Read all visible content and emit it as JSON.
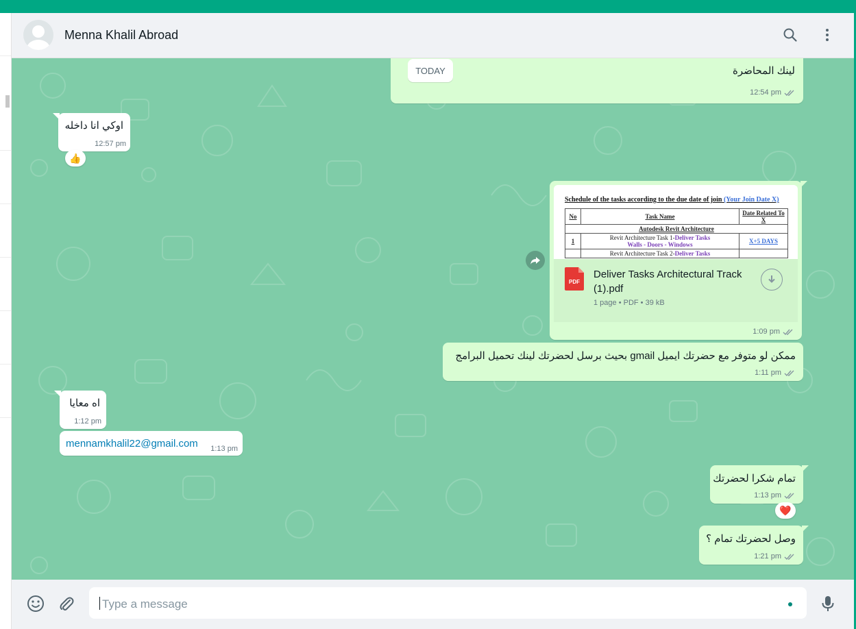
{
  "colors": {
    "accent": "#00a884",
    "chat_bg": "#7fcca8",
    "outgoing": "#d9fdd3",
    "incoming": "#ffffff"
  },
  "header": {
    "contact_name": "Menna Khalil Abroad",
    "icons": [
      "search-icon",
      "menu-dots-icon"
    ]
  },
  "chat": {
    "messages": [
      {
        "dir": "out",
        "text": "لينك المحاضرة",
        "chip": "TODAY",
        "time": "12:54 pm",
        "status": "read"
      },
      {
        "dir": "in",
        "text": "اوكي انا داخله",
        "time": "12:57 pm",
        "reaction": "👍"
      },
      {
        "dir": "out",
        "type": "document",
        "time": "1:09 pm",
        "status": "read",
        "file_name": "Deliver Tasks Architectural Track (1).pdf",
        "file_icon_label": "PDF",
        "file_info": "1 page • PDF • 39 kB",
        "preview": {
          "title": "Schedule of the tasks according to the due date of join",
          "title_link": "(Your Join Date  X)",
          "headers": [
            "No",
            "Task Name",
            "Date Related To X"
          ],
          "section": "Autodesk Revit Architecture",
          "row1": {
            "no": "1",
            "task_prefix": "Revit Architecture Task 1-",
            "task_highlight": "Deliver Tasks",
            "task_sub": "Walls - Doors - Windows",
            "date": "X+5 DAYS"
          },
          "row2": {
            "task_prefix": "Revit Architecture Task 2-",
            "task_highlight": "Deliver Tasks"
          }
        }
      },
      {
        "dir": "out",
        "text": "ممكن لو متوفر مع حضرتك ايميل gmail  بحيث برسل لحضرتك لينك تحميل البرامج",
        "time": "1:11 pm",
        "status": "read"
      },
      {
        "dir": "in",
        "text": "اه معايا",
        "time": "1:12 pm"
      },
      {
        "dir": "in",
        "text": "mennamkhalil22@gmail.com",
        "time": "1:13 pm",
        "is_link": true
      },
      {
        "dir": "out",
        "text": "تمام شكرا لحضرتك",
        "time": "1:13 pm",
        "status": "read",
        "reaction": "❤️"
      },
      {
        "dir": "out",
        "text": "وصل لحضرتك تمام ؟",
        "time": "1:21 pm",
        "status": "read"
      }
    ]
  },
  "composer": {
    "placeholder": "Type a message",
    "icons": [
      "emoji-icon",
      "attach-icon",
      "mic-icon"
    ]
  }
}
